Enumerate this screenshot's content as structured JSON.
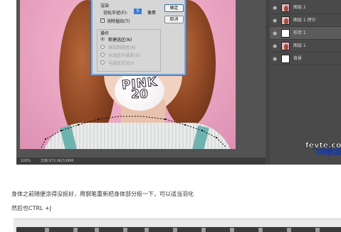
{
  "dialog": {
    "title": "渲染",
    "feather_label": "羽化半径(F):",
    "feather_value": "5",
    "feather_unit": "像素",
    "antialias_label": "消除锯齿(T)",
    "ops_title": "操作",
    "op_new": "新建选区(N)",
    "op_add": "添加到选区(A)",
    "op_subtract": "从选区中减去(S)",
    "op_intersect": "与选区交叉(I)",
    "ok": "确定",
    "cancel": "取消"
  },
  "canvas": {
    "pink_text": "PINK",
    "pink_number": "20"
  },
  "status": {
    "zoom": "100%",
    "doc": "文档:972.0K/3.66M"
  },
  "layers": [
    {
      "name": "图层 2",
      "selected": false
    },
    {
      "name": "图层 1 拷贝",
      "selected": false
    },
    {
      "name": "形状 1",
      "selected": true
    },
    {
      "name": "图层 1",
      "selected": false
    },
    {
      "name": "背景",
      "selected": false
    }
  ],
  "watermark": {
    "site": "fevte.com",
    "brand": "飞特教程"
  },
  "article": {
    "line1": "身体之前随便涂得没抠好，用钢笔重新把身体部分抠一下，可以适当羽化",
    "line2": "然后也CTRL +J"
  },
  "colors": {
    "accent_blue": "#3d7bd6",
    "panel_dark": "#4a4a4a",
    "canvas_pink": "#eaa6c2"
  }
}
